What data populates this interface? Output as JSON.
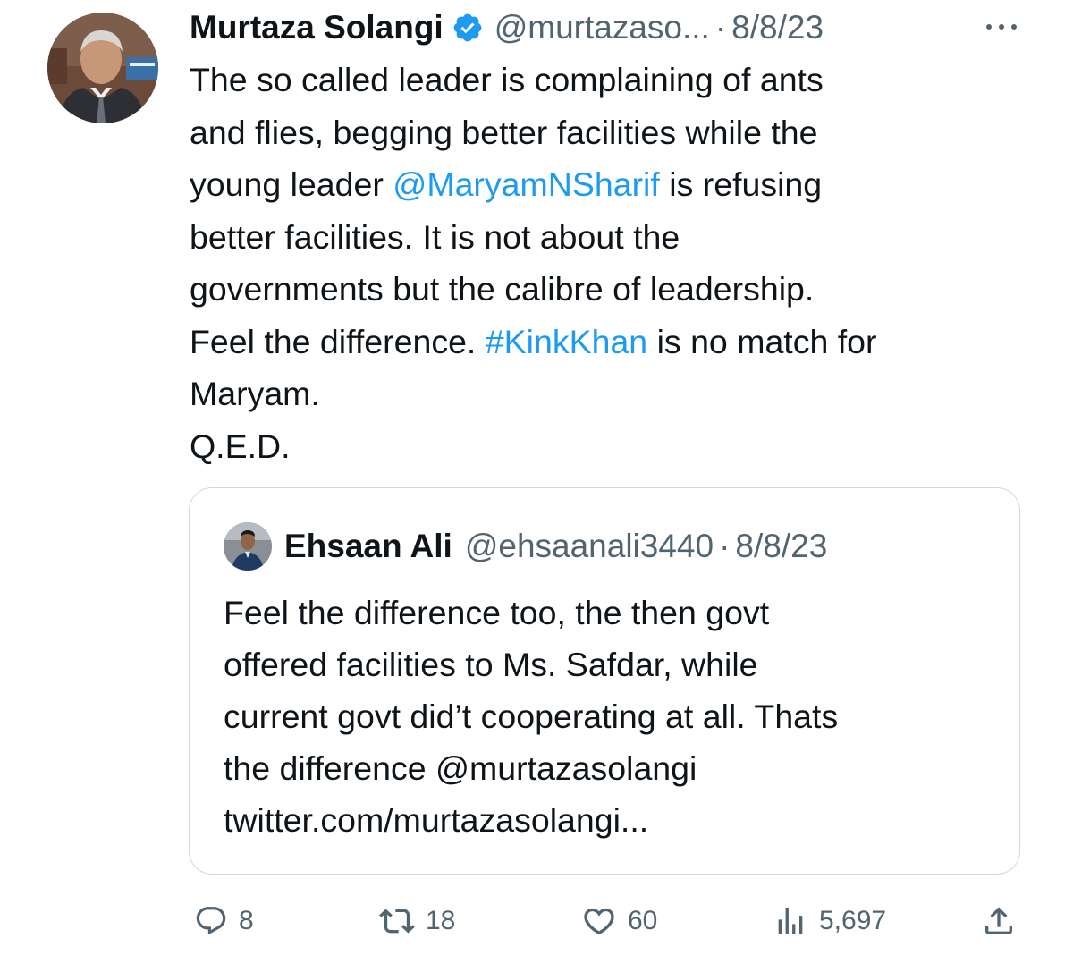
{
  "author": {
    "display_name": "Murtaza Solangi",
    "handle": "@murtazaso...",
    "separator": "·",
    "date": "8/8/23"
  },
  "tweet": {
    "lines": [
      [
        {
          "t": "The so called leader is complaining of ants"
        }
      ],
      [
        {
          "t": "and flies, begging better facilities while the"
        }
      ],
      [
        {
          "t": "young leader "
        },
        {
          "t": "@MaryamNSharif",
          "link": true
        },
        {
          "t": " is refusing"
        }
      ],
      [
        {
          "t": "better facilities. It is not about the"
        }
      ],
      [
        {
          "t": "governments but the calibre of leadership."
        }
      ],
      [
        {
          "t": "Feel the difference. "
        },
        {
          "t": "#KinkKhan",
          "link": true
        },
        {
          "t": " is no match for"
        }
      ],
      [
        {
          "t": "Maryam."
        }
      ],
      [
        {
          "t": "Q.E.D."
        }
      ]
    ]
  },
  "quoted": {
    "display_name": "Ehsaan Ali",
    "handle": "@ehsaanali3440",
    "separator": "·",
    "date": "8/8/23",
    "lines": [
      "Feel the difference too, the then govt",
      "offered facilities to Ms. Safdar, while",
      "current govt did’t cooperating at all. Thats",
      "the difference @murtazasolangi",
      "twitter.com/murtazasolangi..."
    ]
  },
  "actions": {
    "replies": "8",
    "retweets": "18",
    "likes": "60",
    "views": "5,697"
  },
  "colors": {
    "text": "#0f1419",
    "secondary": "#536471",
    "link": "#1d9bf0",
    "verified": "#1d9bf0",
    "border": "#cfd9de"
  },
  "icons": [
    "verified-badge-icon",
    "more-options-icon",
    "reply-icon",
    "retweet-icon",
    "like-icon",
    "views-icon",
    "share-icon"
  ]
}
